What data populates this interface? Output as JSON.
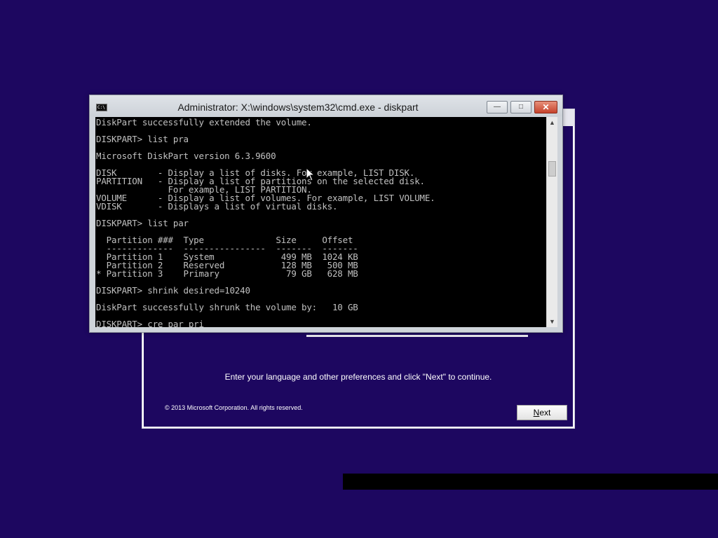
{
  "setup": {
    "instructions": "Enter your language and other preferences and click \"Next\" to continue.",
    "copyright": "© 2013 Microsoft Corporation. All rights reserved.",
    "next_label_prefix": "N",
    "next_label_rest": "ext"
  },
  "cmd": {
    "title": "Administrator: X:\\windows\\system32\\cmd.exe - diskpart",
    "icon_text": "C:\\",
    "minimize_glyph": "—",
    "maximize_glyph": "□",
    "close_glyph": "✕",
    "scroll_up_glyph": "▲",
    "scroll_down_glyph": "▼",
    "lines": [
      "DiskPart successfully extended the volume.",
      "",
      "DISKPART> list pra",
      "",
      "Microsoft DiskPart version 6.3.9600",
      "",
      "DISK        - Display a list of disks. For example, LIST DISK.",
      "PARTITION   - Display a list of partitions on the selected disk.",
      "              For example, LIST PARTITION.",
      "VOLUME      - Display a list of volumes. For example, LIST VOLUME.",
      "VDISK       - Displays a list of virtual disks.",
      "",
      "DISKPART> list par",
      "",
      "  Partition ###  Type              Size     Offset",
      "  -------------  ----------------  -------  -------",
      "  Partition 1    System             499 MB  1024 KB",
      "  Partition 2    Reserved           128 MB   500 MB",
      "* Partition 3    Primary             79 GB   628 MB",
      "",
      "DISKPART> shrink desired=10240",
      "",
      "DiskPart successfully shrunk the volume by:   10 GB",
      "",
      "DISKPART> cre par pri"
    ]
  },
  "colors": {
    "desktop_background": "#1d0760",
    "console_background": "#000000",
    "console_text": "#c0c0c0",
    "close_button": "#c6432c"
  }
}
